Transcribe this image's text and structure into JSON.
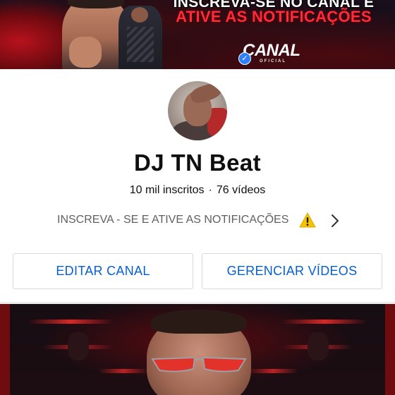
{
  "banner": {
    "line1": "INSCREVA-SE NO CANAL E",
    "line2": "ATIVE AS NOTIFICAÇÕES",
    "logo_word": "CANAL",
    "logo_sub": "OFICIAL",
    "line2_color": "#ff2a3a"
  },
  "channel": {
    "name": "DJ TN Beat",
    "subscribers": "10 mil inscritos",
    "separator": "·",
    "videos": "76 vídeos",
    "description": "INSCREVA - SE E ATIVE AS NOTIFICAÇÕES",
    "description_icon": "warning-icon",
    "chevron_icon": "chevron-right-icon"
  },
  "actions": {
    "edit_label": "EDITAR CANAL",
    "manage_label": "GERENCIAR VÍDEOS",
    "accent_color": "#065fd4"
  }
}
